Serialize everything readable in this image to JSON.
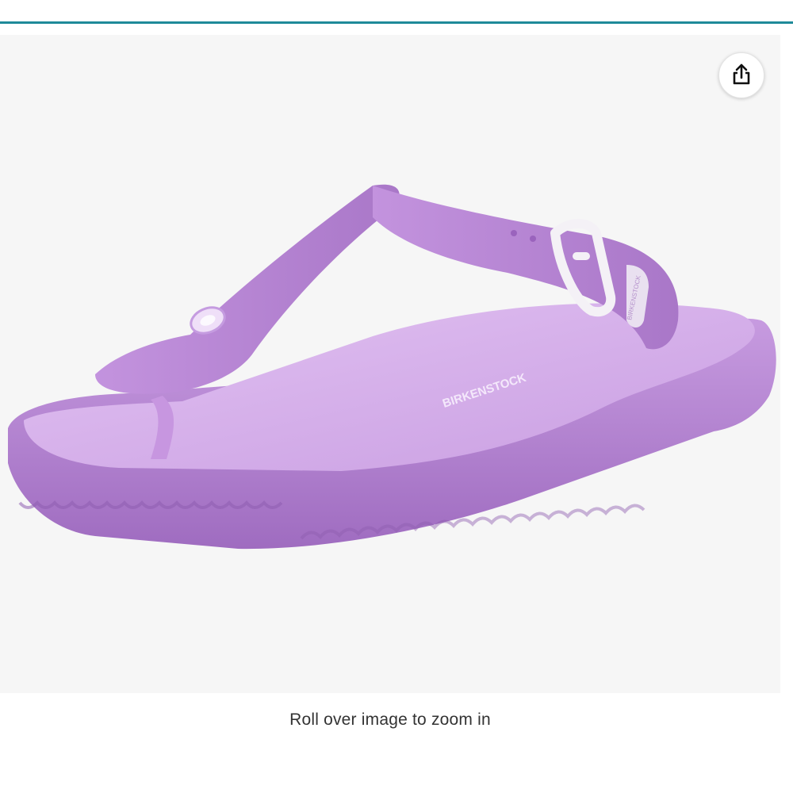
{
  "colors": {
    "accent_rule": "#1f8a99",
    "panel_background": "#f6f6f6",
    "product_color": "#b98ad6"
  },
  "share": {
    "icon": "share-icon"
  },
  "product_image": {
    "brand_imprint": "BIRKENSTOCK",
    "buckle_imprint": "BIRKENSTOCK"
  },
  "zoom_hint": "Roll over image to zoom in"
}
